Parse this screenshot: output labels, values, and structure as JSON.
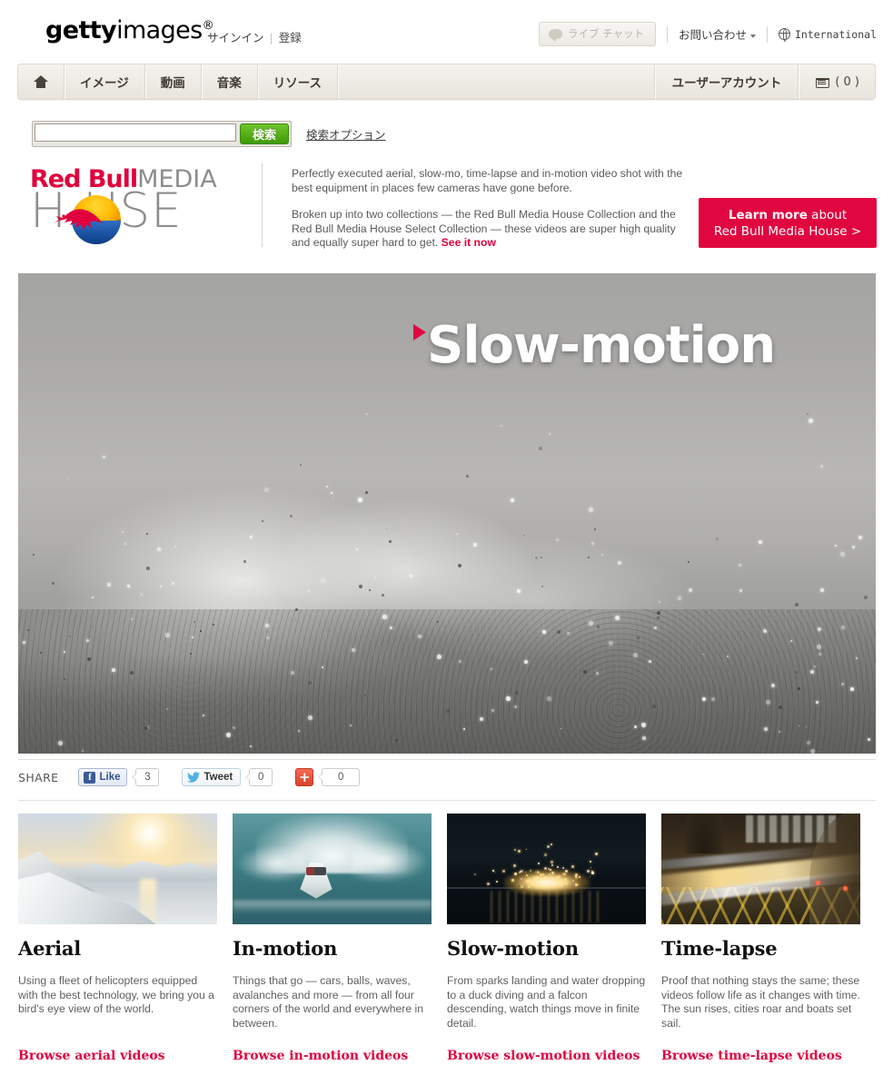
{
  "header": {
    "logo_bold": "getty",
    "logo_light": "images",
    "logo_reg": "®",
    "signin": "サインイン",
    "register": "登録",
    "live_chat": "ライブ チャット",
    "contact": "お問い合わせ",
    "international": "International"
  },
  "nav": {
    "home_label": "",
    "items": [
      {
        "label": "イメージ"
      },
      {
        "label": "動画"
      },
      {
        "label": "音楽"
      },
      {
        "label": "リソース"
      }
    ],
    "account": "ユーザーアカウント",
    "cart_count": "( 0 )"
  },
  "search": {
    "value": "",
    "placeholder": "",
    "button_label": "検索",
    "options_label": "検索オプション"
  },
  "promo": {
    "brand_red": "Red Bull",
    "brand_grey": "MEDIA",
    "brand_line2": "H   USE",
    "paragraph1": "Perfectly executed aerial, slow-mo, time-lapse and in-motion video shot with the best equipment in places few cameras have gone before.",
    "paragraph2": "Broken up into two collections — the Red Bull Media House Collection and the Red Bull Media House Select Collection — these videos are super high quality and equally super hard to get.",
    "see_it_now": "See it now",
    "cta_line1_bold": "Learn more",
    "cta_line1_rest": " about",
    "cta_line2": "Red Bull Media House >"
  },
  "hero": {
    "title": "Slow-motion",
    "play_icon": "play-triangle-icon"
  },
  "share": {
    "label": "SHARE",
    "facebook_label": "Like",
    "facebook_glyph": "f",
    "facebook_count": "3",
    "twitter_label": "Tweet",
    "twitter_count": "0",
    "googleplus_glyph": "+",
    "googleplus_count": "0"
  },
  "cards": [
    {
      "thumb": "aerial-sunset-mountains-thumbnail",
      "title": "Aerial",
      "desc": "Using a fleet of helicopters equipped with the best technology, we bring you a bird's eye view of the world.",
      "link": "Browse aerial videos"
    },
    {
      "thumb": "speedboat-wake-thumbnail",
      "title": "In-motion",
      "desc": "Things that go — cars, balls, waves, avalanches and more — from all four corners of the world and everywhere in between.",
      "link": "Browse in-motion videos"
    },
    {
      "thumb": "sparks-water-thumbnail",
      "title": "Slow-motion",
      "desc": "From sparks landing and water dropping to a duck diving and a falcon descending, watch things move in finite detail.",
      "link": "Browse slow-motion videos"
    },
    {
      "thumb": "night-traffic-light-trails-thumbnail",
      "title": "Time-lapse",
      "desc": "Proof that nothing stays the same; these videos follow life as it changes with time. The sun rises, cities roar and boats set sail.",
      "link": "Browse time-lapse videos"
    }
  ],
  "colors": {
    "brand_red": "#e0063f",
    "search_green": "#3f9a06",
    "nav_beige": "#e8e5dd",
    "text_grey": "#5f5f5f"
  }
}
